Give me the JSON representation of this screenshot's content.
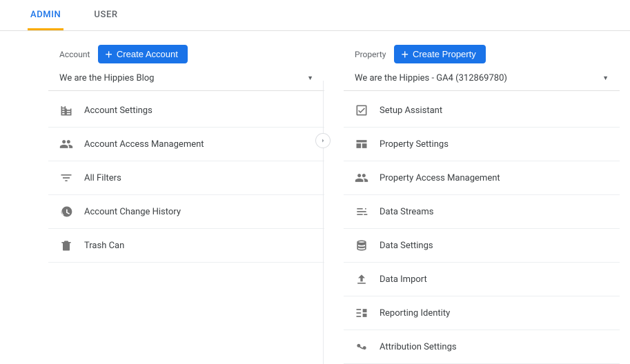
{
  "tabs": {
    "admin": "ADMIN",
    "user": "USER"
  },
  "account": {
    "label": "Account",
    "createLabel": "Create Account",
    "selected": "We are the Hippies Blog",
    "items": [
      {
        "label": "Account Settings",
        "icon": "building-icon"
      },
      {
        "label": "Account Access Management",
        "icon": "people-icon"
      },
      {
        "label": "All Filters",
        "icon": "filter-icon"
      },
      {
        "label": "Account Change History",
        "icon": "history-icon"
      },
      {
        "label": "Trash Can",
        "icon": "trash-icon"
      }
    ]
  },
  "property": {
    "label": "Property",
    "createLabel": "Create Property",
    "selected": "We are the Hippies - GA4 (312869780)",
    "items": [
      {
        "label": "Setup Assistant",
        "icon": "checkbox-icon"
      },
      {
        "label": "Property Settings",
        "icon": "layout-icon"
      },
      {
        "label": "Property Access Management",
        "icon": "people-icon"
      },
      {
        "label": "Data Streams",
        "icon": "streams-icon"
      },
      {
        "label": "Data Settings",
        "icon": "database-icon"
      },
      {
        "label": "Data Import",
        "icon": "upload-icon"
      },
      {
        "label": "Reporting Identity",
        "icon": "identity-icon"
      },
      {
        "label": "Attribution Settings",
        "icon": "attribution-icon"
      }
    ]
  }
}
